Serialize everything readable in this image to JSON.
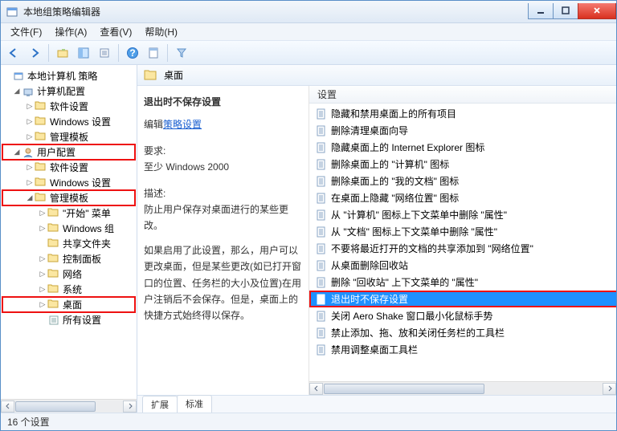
{
  "window": {
    "title": "本地组策略编辑器"
  },
  "menu": {
    "file": "文件(F)",
    "action": "操作(A)",
    "view": "查看(V)",
    "help": "帮助(H)"
  },
  "tree": {
    "root": "本地计算机 策略",
    "computer": "计算机配置",
    "c_soft": "软件设置",
    "c_windows": "Windows 设置",
    "c_admin": "管理模板",
    "user": "用户配置",
    "u_soft": "软件设置",
    "u_windows": "Windows 设置",
    "u_admin": "管理模板",
    "u_start": "\"开始\" 菜单",
    "u_wincomp": "Windows 组",
    "u_shared": "共享文件夹",
    "u_cpl": "控制面板",
    "u_net": "网络",
    "u_sys": "系统",
    "u_desktop": "桌面",
    "u_all": "所有设置"
  },
  "header": {
    "folder": "桌面"
  },
  "desc": {
    "heading": "退出时不保存设置",
    "edit_prefix": "编辑",
    "edit_link": "策略设置",
    "req_label": "要求:",
    "req_value": "至少 Windows 2000",
    "desc_label": "描述:",
    "desc_body1": "防止用户保存对桌面进行的某些更改。",
    "desc_body2": "如果启用了此设置，那么，用户可以更改桌面，但是某些更改(如已打开窗口的位置、任务栏的大小及位置)在用户注销后不会保存。但是，桌面上的快捷方式始终得以保存。"
  },
  "listHeader": "设置",
  "items": [
    "隐藏和禁用桌面上的所有项目",
    "删除清理桌面向导",
    "隐藏桌面上的 Internet Explorer 图标",
    "删除桌面上的 \"计算机\" 图标",
    "删除桌面上的 \"我的文档\" 图标",
    "在桌面上隐藏 \"网络位置\" 图标",
    "从 \"计算机\" 图标上下文菜单中删除 \"属性\"",
    "从 \"文档\" 图标上下文菜单中删除 \"属性\"",
    "不要将最近打开的文档的共享添加到 \"网络位置\"",
    "从桌面删除回收站",
    "删除 \"回收站\" 上下文菜单的 \"属性\"",
    "退出时不保存设置",
    "关闭 Aero Shake 窗口最小化鼠标手势",
    "禁止添加、拖、放和关闭任务栏的工具栏",
    "禁用调整桌面工具栏"
  ],
  "selectedIndex": 11,
  "tabs": {
    "extended": "扩展",
    "standard": "标准"
  },
  "status": "16 个设置"
}
